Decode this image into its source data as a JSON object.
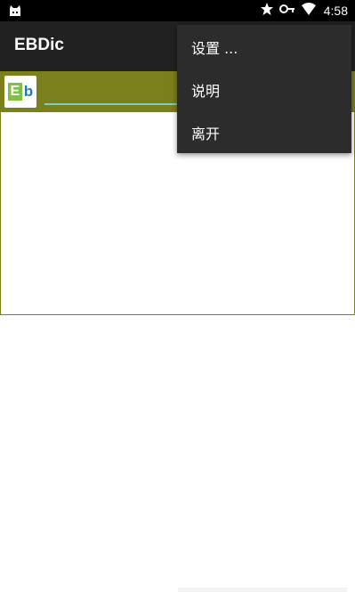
{
  "status_bar": {
    "time": "4:58",
    "icons": [
      "android-cat-icon",
      "star-icon",
      "key-icon",
      "wifi-icon"
    ]
  },
  "app_bar": {
    "title": "EBDic"
  },
  "search": {
    "logo_letters": [
      "E",
      "b"
    ],
    "value": ""
  },
  "overflow_menu": {
    "items": [
      {
        "label": "设置 ..."
      },
      {
        "label": "说明"
      },
      {
        "label": "离开"
      }
    ]
  },
  "colors": {
    "status_bar": "#000000",
    "app_bar": "#212121",
    "search_strip": "#7b7f1c",
    "menu_bg": "#2c2c2c",
    "input_underline": "#80cbc4",
    "logo_green": "#7dc242",
    "logo_blue": "#1f79b6"
  }
}
